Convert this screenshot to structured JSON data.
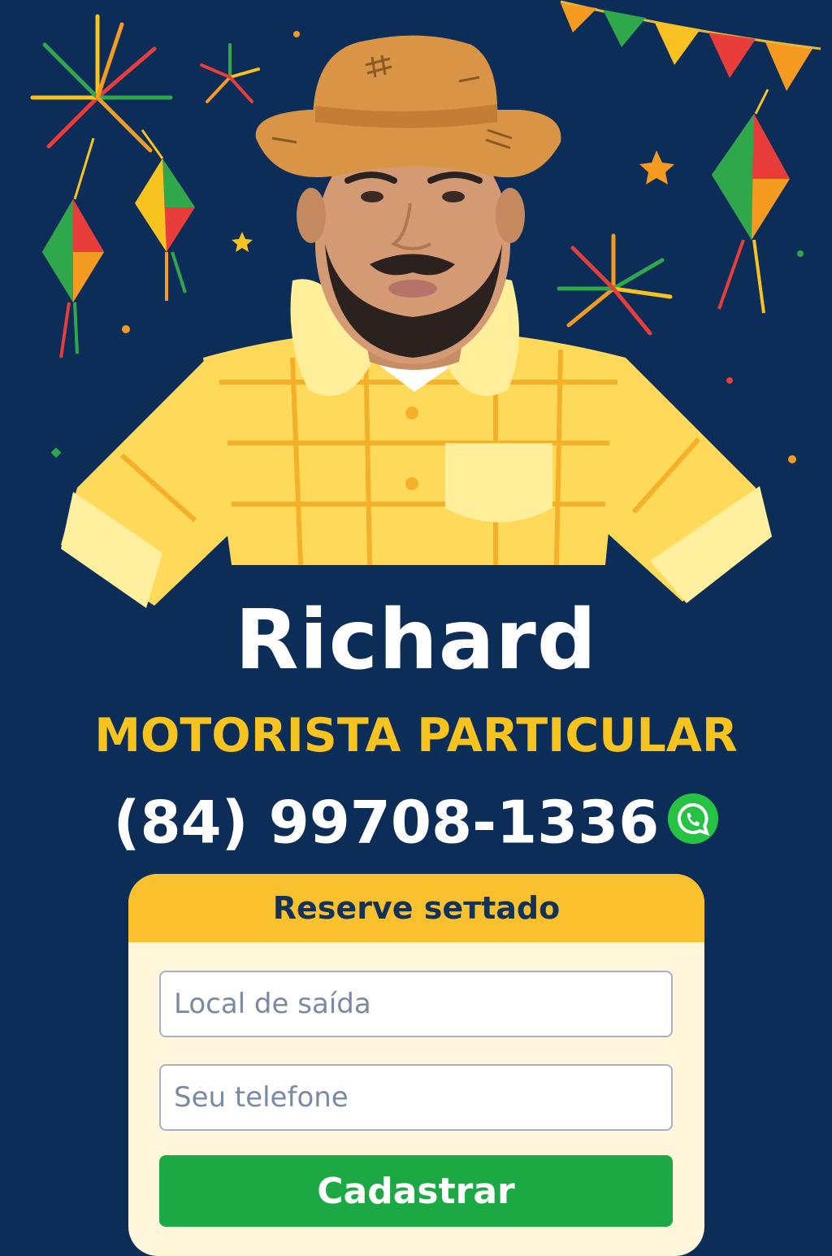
{
  "profile": {
    "name": "Richard",
    "role": "MOTORISTA PARTICULAR",
    "phone": "(84) 99708-1336"
  },
  "icons": {
    "contact": "whatsapp-icon",
    "decorations": [
      "fireworks-icon",
      "paper-lantern-icon",
      "bunting-flags-icon",
      "star-icon"
    ]
  },
  "reservation_form": {
    "title": "Reserve seтtado",
    "departure_placeholder": "Local de saída",
    "phone_placeholder": "Seu telefone",
    "submit_label": "Cadastrar"
  },
  "colors": {
    "background": "#0c2d57",
    "accent_yellow": "#f7c31e",
    "button_green": "#1ca944",
    "whatsapp_green": "#25c244"
  }
}
